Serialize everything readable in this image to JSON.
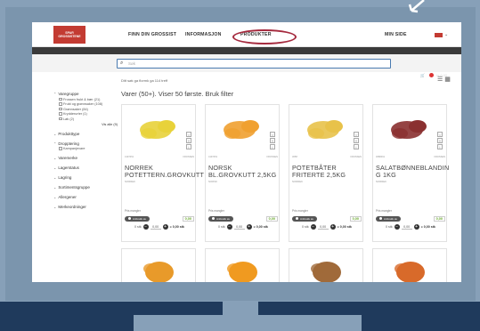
{
  "nav": {
    "logo_line1": "SPAR",
    "logo_line2": "GROSSISTENE",
    "items": [
      "FINN DIN GROSSIST",
      "INFORMASJON",
      "PRODUKTER"
    ],
    "my_page": "MIN SIDE",
    "cart_label": "kr 0,00",
    "cart_count": "0"
  },
  "search": {
    "placeholder": "Søk"
  },
  "results": {
    "hits": "Ditt søk ga flormk ga 114 treff",
    "heading": "Varer (50+). Viser 50 første. Bruk filter"
  },
  "sidebar": {
    "groups": [
      {
        "label": "Varegruppe",
        "expanded": true,
        "options": [
          "Frossen frukt & bær (21)",
          "Frukt og grønnsaker (108)",
          "Grønnsaker (84)",
          "Krydderurter (1)",
          "Løk (2)"
        ],
        "show_all": "Vis alle (9)"
      },
      {
        "label": "Produkttype",
        "expanded": false
      },
      {
        "label": "Dropptering",
        "expanded": true,
        "options": [
          "Kampanjevare"
        ]
      },
      {
        "label": "Varemerke",
        "expanded": false
      },
      {
        "label": "Lagerstatus",
        "expanded": false
      },
      {
        "label": "Lagring",
        "expanded": false
      },
      {
        "label": "Sortimentsgruppe",
        "expanded": false
      },
      {
        "label": "Allergener",
        "expanded": false
      },
      {
        "label": "Merkeordninger",
        "expanded": false
      }
    ]
  },
  "products": [
    {
      "name": "NORREK POTETTERN.GROVKUTT",
      "weight": "NORREK",
      "code": "4197451",
      "tag": "FROSSEN",
      "price_label": "Pris mangler",
      "order_label": "Anbrekk av",
      "order_amount": "0,00",
      "qty_text": "0 stk",
      "qty_value": "0,00",
      "total": "= 0,00 stk",
      "color": "#e8d23a"
    },
    {
      "name": "NORSK BL.GROVKUTT 2,5KG",
      "weight": "NORSK",
      "code": "4197451",
      "tag": "FROSSEN",
      "price_label": "Pris mangler",
      "order_label": "Anbrekk av",
      "order_amount": "0,00",
      "qty_text": "0 stk",
      "qty_value": "0,00",
      "total": "= 0,00 stk",
      "color": "#f0a030"
    },
    {
      "name": "POTETBÅTER FRITERTE 2,5KG",
      "weight": "NORREK",
      "code": "3058",
      "tag": "FROSSEN",
      "price_label": "Pris mangler",
      "order_label": "Anbrekk av",
      "order_amount": "0,00",
      "qty_text": "0 stk",
      "qty_value": "0,00",
      "total": "= 0,00 stk",
      "color": "#e8c24a"
    },
    {
      "name": "SALATBØNNEBLANDIN G 1KG",
      "weight": "NORREK",
      "code": "3088461",
      "tag": "FROSSEN",
      "price_label": "Pris mangler",
      "order_label": "Anbrekk av",
      "order_amount": "0,00",
      "qty_text": "0 stk",
      "qty_value": "0,00",
      "total": "= 0,00 stk",
      "color": "#8a3030"
    }
  ],
  "row2_colors": [
    "#e89a2a",
    "#f09a20",
    "#a06a3a",
    "#d86a2a"
  ]
}
